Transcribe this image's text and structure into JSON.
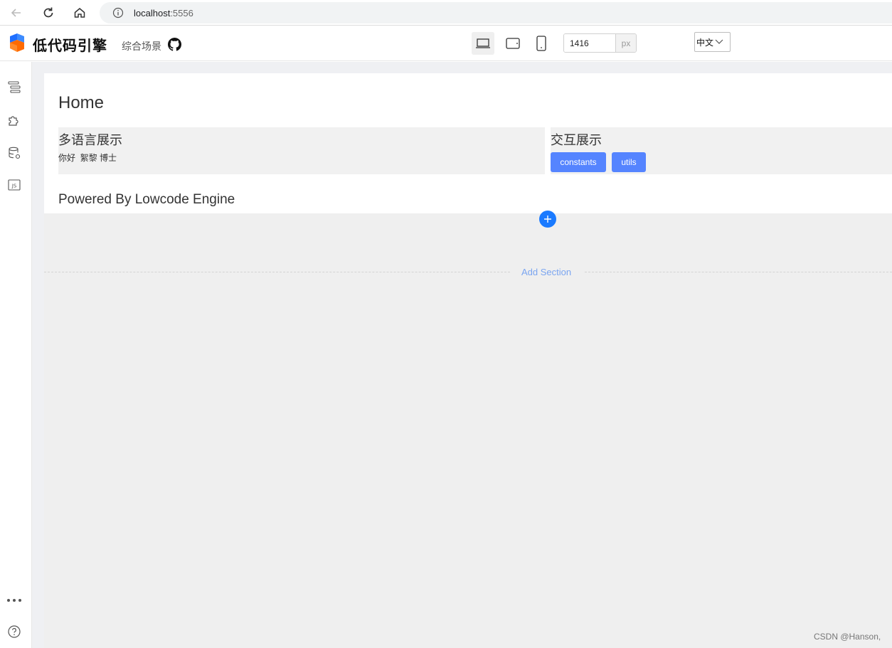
{
  "browser": {
    "url_host": "localhost",
    "url_port": ":5556"
  },
  "topbar": {
    "logo_text": "低代码引擎",
    "scene_label": "综合场景",
    "width_value": "1416",
    "width_unit": "px",
    "language": "中文"
  },
  "page": {
    "title": "Home",
    "i18n_block": {
      "title": "多语言展示",
      "text": "你好  絮黎 博士"
    },
    "interaction_block": {
      "title": "交互展示",
      "buttons": [
        "constants",
        "utils"
      ]
    },
    "powered_by": "Powered By Lowcode Engine",
    "add_section": "Add Section"
  },
  "watermark": "CSDN @Hanson,",
  "colors": {
    "primary_button": "#5584ff",
    "add_circle": "#1a7aff",
    "add_section_text": "#7aa5f0"
  }
}
